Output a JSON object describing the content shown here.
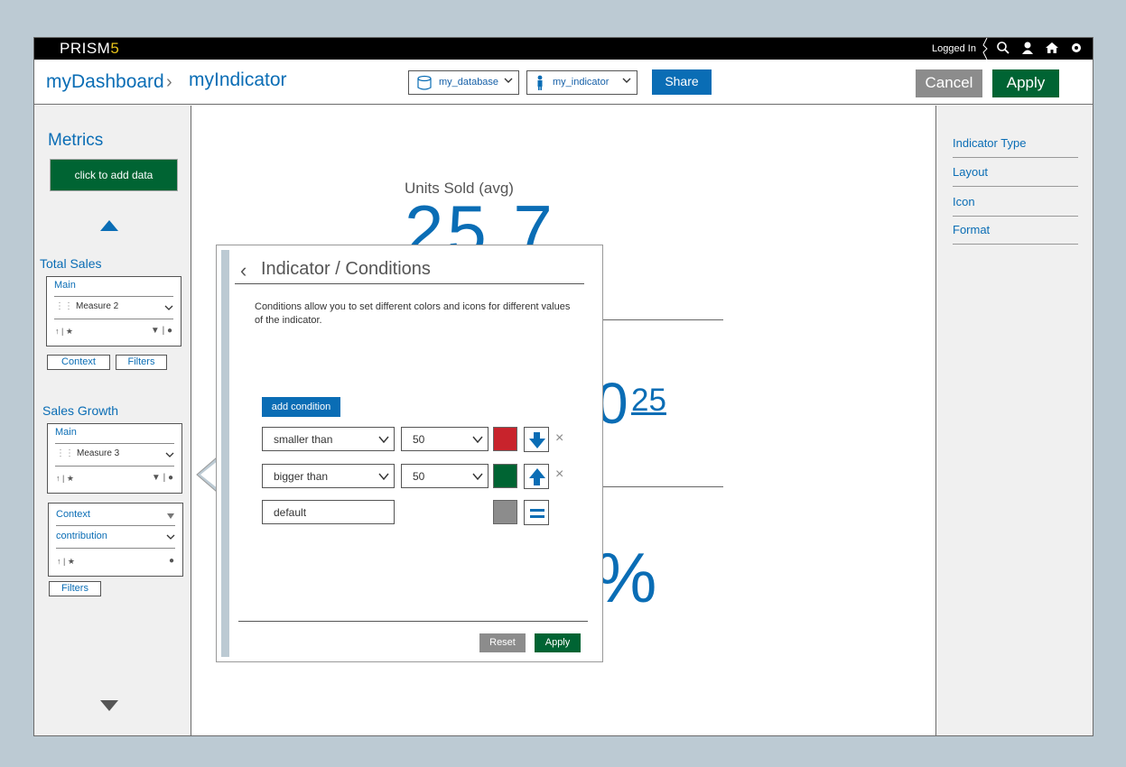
{
  "topbar": {
    "logo_text": "PRISM",
    "logo_num": "5",
    "logged_in": "Logged In",
    "icons": [
      "search-icon",
      "user-icon",
      "home-icon",
      "settings-icon"
    ]
  },
  "header": {
    "crumb_root": "myDashboard",
    "crumb_current": "myIndicator",
    "database_select": "my_database",
    "indicator_select": "my_indicator",
    "share": "Share",
    "cancel": "Cancel",
    "apply": "Apply"
  },
  "left": {
    "title": "Metrics",
    "add_data": "click to add data",
    "total_sales": {
      "title": "Total Sales",
      "main": "Main",
      "measure": "Measure 2",
      "icons_left": "↑ | ★",
      "context_btn": "Context",
      "filters_btn": "Filters"
    },
    "sales_growth": {
      "title": "Sales Growth",
      "main": "Main",
      "measure": "Measure 3",
      "icons_left": "↑ | ★",
      "context": "Context",
      "contribution": "contribution",
      "filters_btn": "Filters"
    }
  },
  "right": {
    "items": [
      "Indicator Type",
      "Layout",
      "Icon",
      "Format"
    ]
  },
  "main": {
    "units_title": "Units Sold (avg)",
    "units_value": "25.7",
    "mid_value": "0",
    "mid_sup": "25",
    "pct": "%"
  },
  "popover": {
    "title": "Indicator / Conditions",
    "description": "Conditions allow you to set different colors and icons for different values of the indicator.",
    "add_condition": "add condition",
    "conditions": [
      {
        "operator": "smaller than",
        "value": "50",
        "color": "#c8232c",
        "icon": "arrow-down-icon"
      },
      {
        "operator": "bigger than",
        "value": "50",
        "color": "#006433",
        "icon": "arrow-up-icon"
      }
    ],
    "default_label": "default",
    "default_color": "#8c8c8c",
    "default_icon": "equals-icon",
    "reset": "Reset",
    "apply": "Apply"
  }
}
